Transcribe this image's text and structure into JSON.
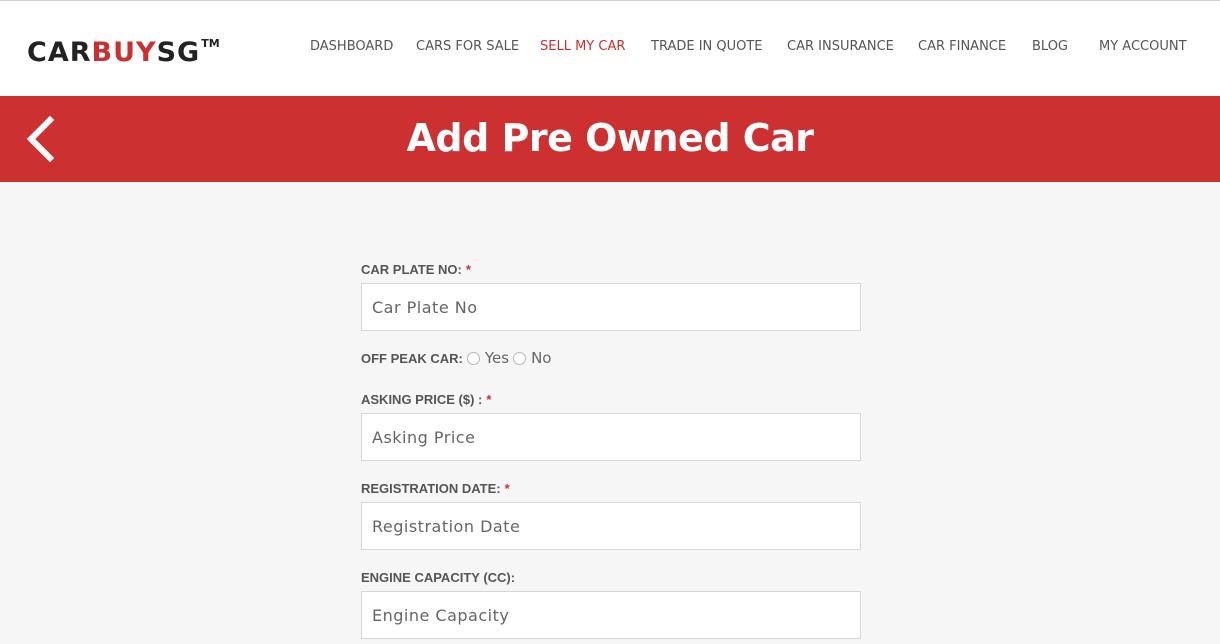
{
  "logo": {
    "part1": "CAR",
    "part2": "BUY",
    "part3": "SG",
    "tm": "TM"
  },
  "nav": {
    "items": [
      {
        "label": "DASHBOARD"
      },
      {
        "label": "CARS FOR SALE"
      },
      {
        "label": "SELL MY CAR"
      },
      {
        "label": "TRADE IN QUOTE"
      },
      {
        "label": "CAR INSURANCE"
      },
      {
        "label": "CAR FINANCE"
      },
      {
        "label": "BLOG"
      },
      {
        "label": "MY ACCOUNT"
      }
    ],
    "active": "SELL MY CAR"
  },
  "banner": {
    "title": "Add Pre Owned Car",
    "back_icon": "chevron-left-icon"
  },
  "form": {
    "car_plate": {
      "label": "CAR PLATE NO:",
      "required": "*",
      "placeholder": "Car Plate No",
      "value": ""
    },
    "off_peak": {
      "label": "OFF PEAK CAR:",
      "options": [
        "Yes",
        "No"
      ],
      "selected": ""
    },
    "asking_price": {
      "label": "ASKING PRICE ($) :",
      "required": "*",
      "placeholder": "Asking Price",
      "value": ""
    },
    "registration_date": {
      "label": "REGISTRATION DATE:",
      "required": "*",
      "placeholder": "Registration Date",
      "value": ""
    },
    "engine_capacity": {
      "label": "ENGINE CAPACITY (CC):",
      "placeholder": "Engine Capacity",
      "value": ""
    }
  },
  "colors": {
    "brand": "#cd3030",
    "text": "#555555",
    "background": "#f6f6f6"
  }
}
